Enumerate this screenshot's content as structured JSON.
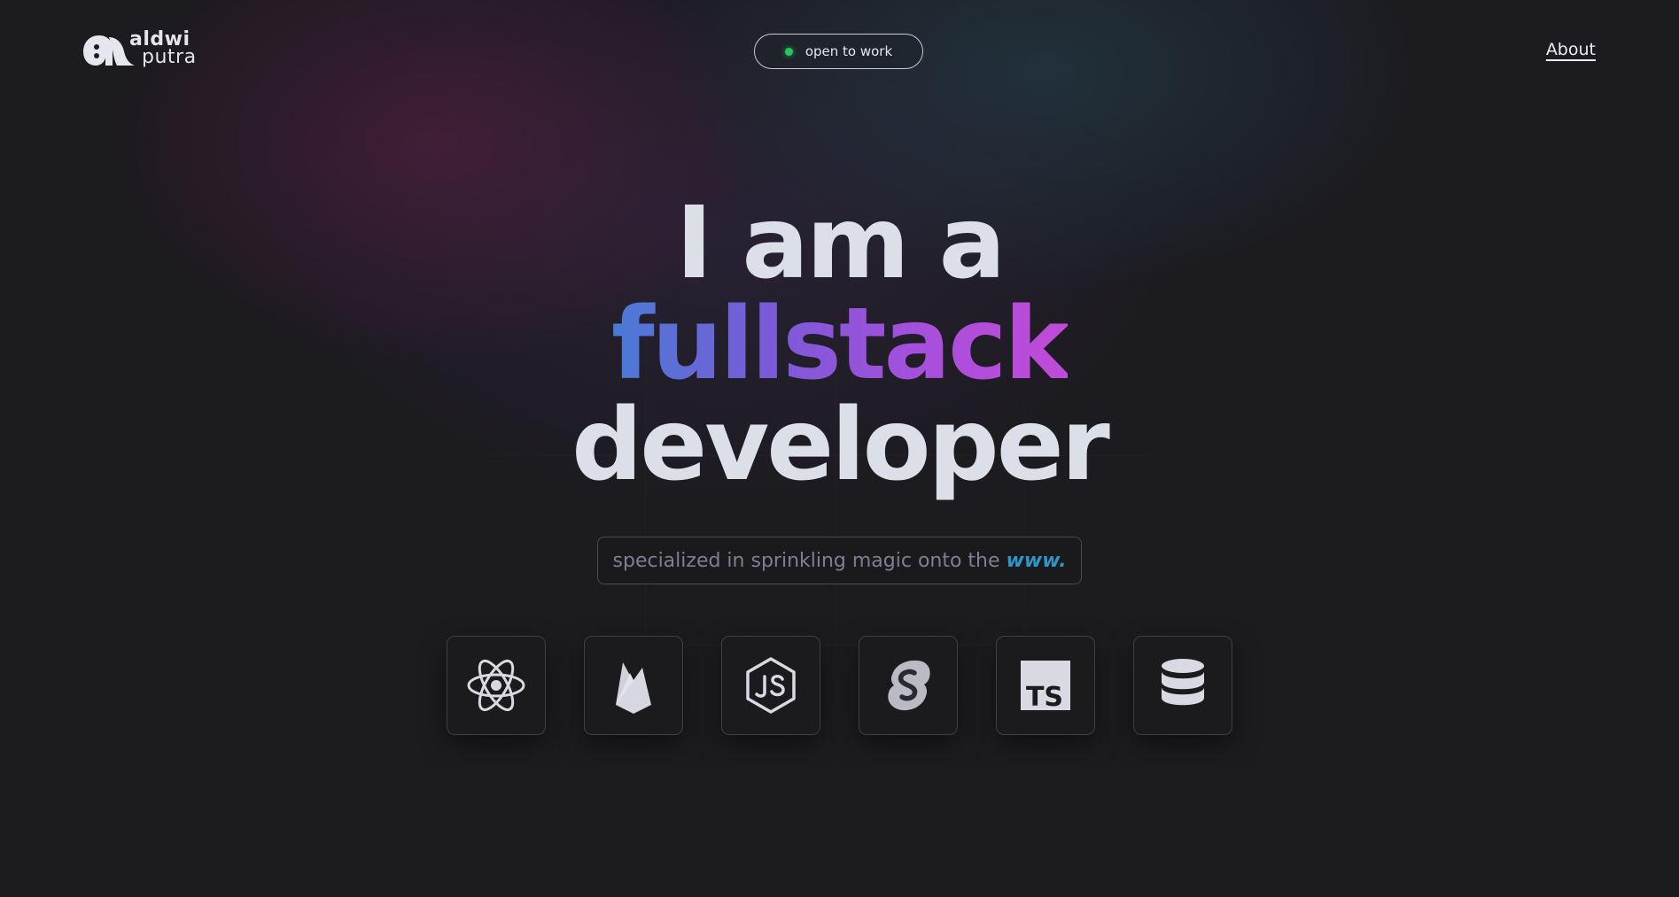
{
  "header": {
    "logo": {
      "line1": "aldwi",
      "line2": "putra",
      "icon": "logo-mark-icon"
    },
    "status": {
      "label": "open to work",
      "dot_color": "#22c55e"
    },
    "nav": {
      "about": "About"
    }
  },
  "hero": {
    "line1": "I am a",
    "line2_prefix": "a ",
    "line2_accent": "fullstack",
    "line3": "developer",
    "accent_gradient": [
      "#4a7bd6",
      "#a94fdc",
      "#c04bd8"
    ]
  },
  "tagline": {
    "text": "specialized in sprinkling magic onto the",
    "accent": "www.",
    "accent_color": "#2f95c6"
  },
  "tech_stack": [
    {
      "name": "React",
      "icon": "react-icon"
    },
    {
      "name": "Firebase",
      "icon": "firebase-icon"
    },
    {
      "name": "Node.js",
      "icon": "nodejs-icon"
    },
    {
      "name": "Svelte",
      "icon": "svelte-icon"
    },
    {
      "name": "TypeScript",
      "icon": "typescript-icon",
      "glyph": "TS"
    },
    {
      "name": "Database",
      "icon": "database-icon"
    }
  ]
}
